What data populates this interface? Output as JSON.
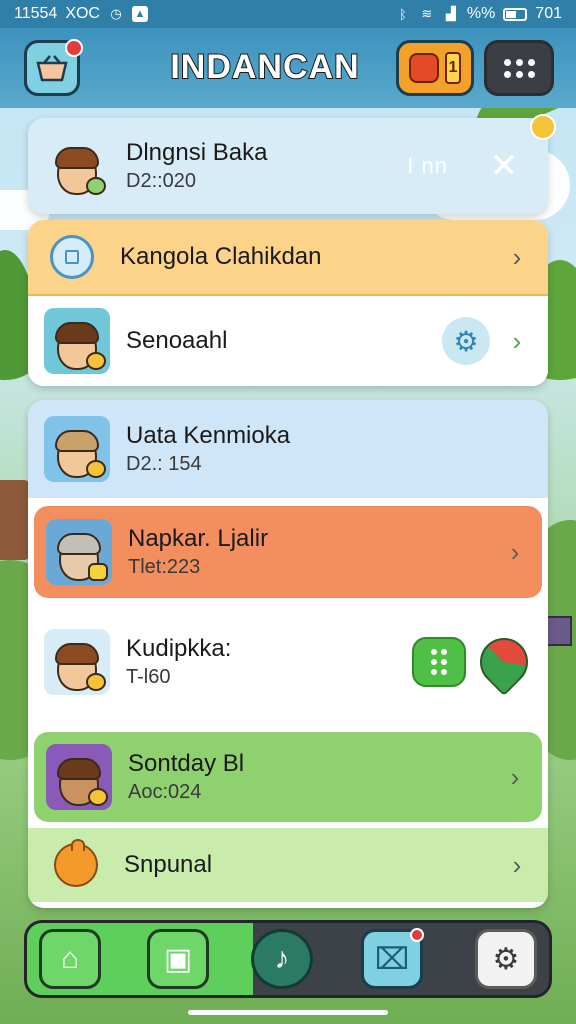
{
  "status_bar": {
    "time_left": "11554",
    "carrier": "XOC",
    "battery_percent": "%%",
    "time_right": "701"
  },
  "header": {
    "title": "INDANCAN",
    "coin_count": "1"
  },
  "cards": {
    "top": {
      "title": "Dlngnsi Baka",
      "subtitle": "D2::020",
      "tag": "I nn",
      "close_glyph": "✕"
    },
    "group_a": [
      {
        "title": "Kangola Clahikdan"
      },
      {
        "title": "Senoaahl"
      }
    ],
    "group_b": [
      {
        "title": "Uata Kenmioka",
        "subtitle": "D2.: 154"
      },
      {
        "title": "Napkar. Ljalir",
        "subtitle": "Tlet:223"
      },
      {
        "title": "Kudipkka:",
        "subtitle": "T-l60"
      },
      {
        "title": "Sontday Bl",
        "subtitle": "Aoc:024"
      },
      {
        "title": "Snpunal"
      }
    ]
  },
  "colors": {
    "accent_blue": "#3d93bd",
    "row_orange": "#f38f5e",
    "row_green": "#8fd16f",
    "row_yellow": "#fbd48a"
  },
  "icons": {
    "header_left": "basket-icon",
    "coin": "creature-coin-icon",
    "menu": "grid-menu-icon",
    "nav": [
      "home-icon",
      "chat-icon",
      "music-note-icon",
      "map-icon",
      "settings-gear-icon"
    ]
  },
  "nav_glyphs": {
    "home": "⌂",
    "chat": "▣",
    "note": "♪",
    "map": "⌧",
    "settings": "⚙"
  },
  "chevron": "›"
}
